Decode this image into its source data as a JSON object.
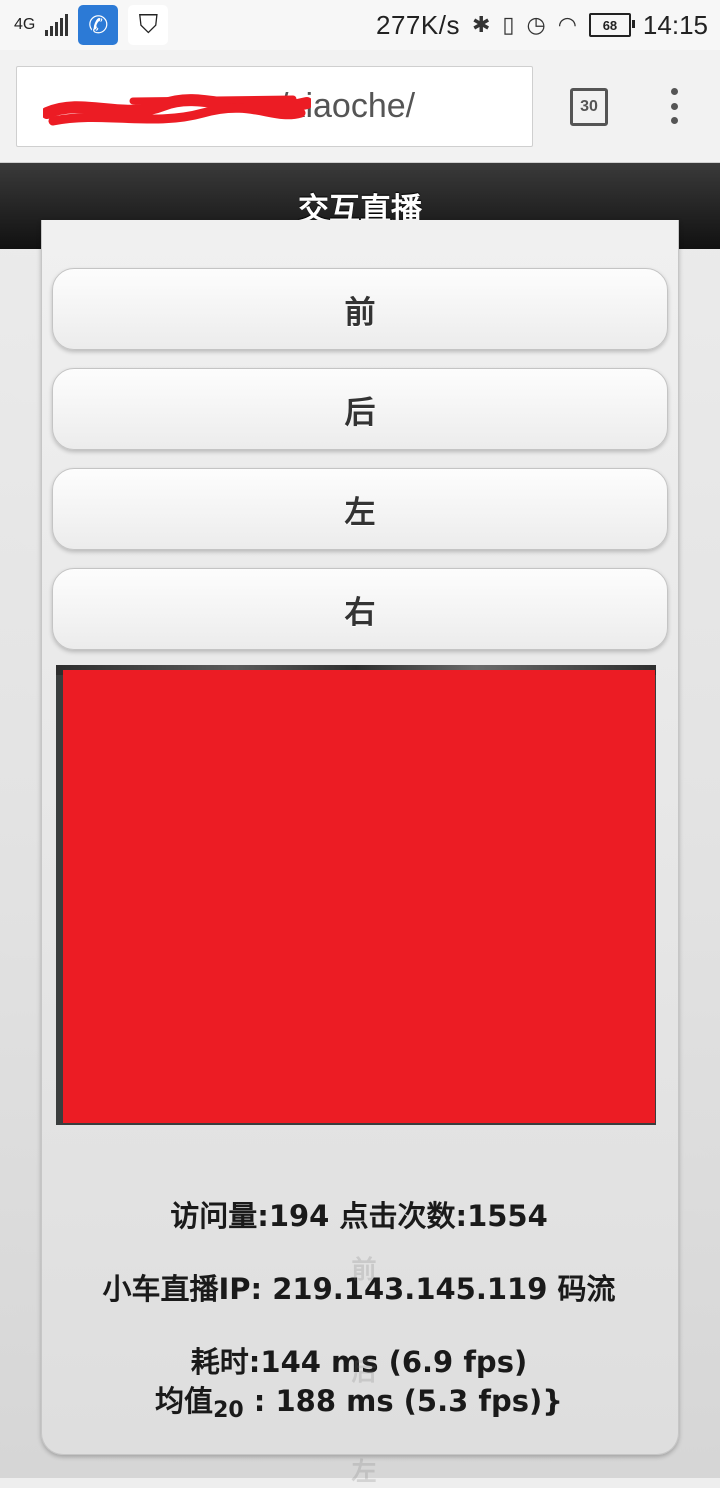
{
  "status_bar": {
    "network_type": "4G",
    "net_speed": "277K/s",
    "battery": "68",
    "time": "14:15",
    "icons": [
      "signal-icon",
      "phone-app-icon",
      "shield-app-icon",
      "bluetooth-icon",
      "vibrate-icon",
      "alarm-icon",
      "wifi-icon",
      "battery-icon"
    ]
  },
  "browser": {
    "url_visible": "/xiaoche/",
    "tab_count": "30"
  },
  "header": {
    "title": "交互直播"
  },
  "controls": {
    "forward": "前",
    "back": "后",
    "left": "左",
    "right": "右"
  },
  "stats": {
    "visits_label": "访问量:",
    "visits": "194",
    "clicks_label": "点击次数:",
    "clicks": "1554",
    "ip_label": "小车直播IP:",
    "ip": "219.143.145.119",
    "stream_label": "码流",
    "elapsed_label": "耗时:",
    "elapsed": "144 ms (6.9 fps)",
    "avg_label": "均值",
    "avg_sub": "20",
    "avg": " : 188 ms (5.3 fps)}"
  },
  "ghost": {
    "a": "前",
    "b": "后",
    "c": "左"
  },
  "colors": {
    "redaction": "#ec1c24",
    "header_bg": "#1a1a1a"
  }
}
